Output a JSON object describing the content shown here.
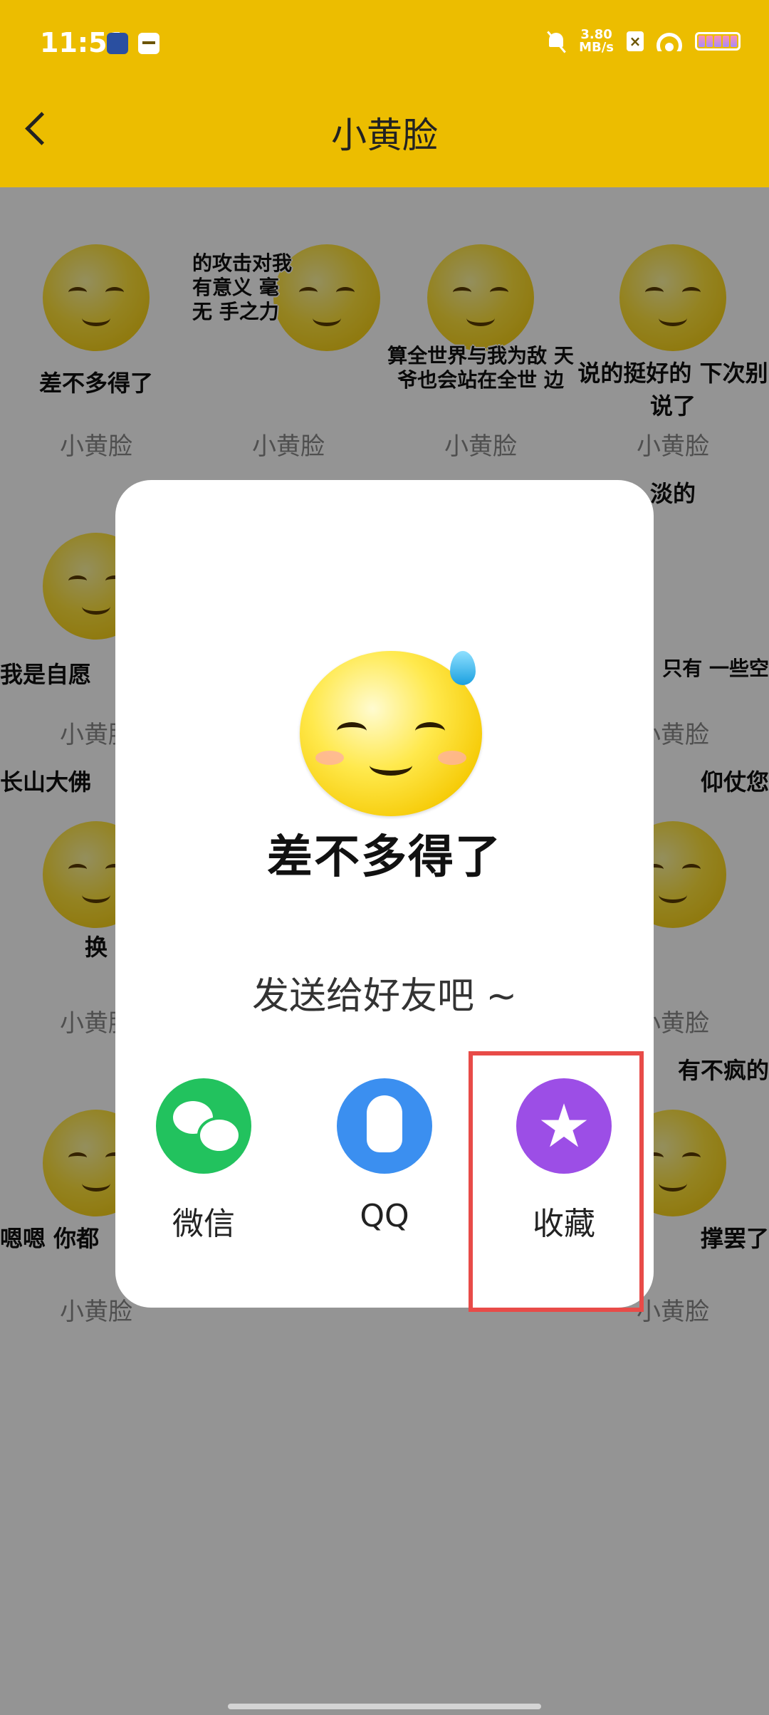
{
  "status_bar": {
    "time": "11:51",
    "net_speed_value": "3.80",
    "net_speed_unit": "MB/s",
    "colors": {
      "background": "#ecbd00"
    }
  },
  "header": {
    "title": "小黄脸",
    "back_icon": "chevron-left-icon"
  },
  "grid": {
    "items": [
      {
        "caption": "差不多得了",
        "name": "小黄脸"
      },
      {
        "caption": "的攻击对我 有意义 毫无 手之力",
        "name": "小黄脸"
      },
      {
        "caption": "算全世界与我为敌 天爷也会站在全世 边",
        "name": "小黄脸"
      },
      {
        "caption": "说的挺好的 下次别说了",
        "name": "小黄脸"
      },
      {
        "caption": "我是自愿",
        "name": "小黄脸"
      },
      {
        "caption": "只有 一些空",
        "name": "小黄脸",
        "top_caption": "淡的"
      },
      {
        "caption": "换",
        "name": "小黄脸",
        "top_caption": "长山大佛"
      },
      {
        "caption": "",
        "name": "小黄脸",
        "top_caption": "仰仗您"
      },
      {
        "caption": "嗯嗯 你都",
        "name": "小黄脸"
      },
      {
        "caption": "撑罢了",
        "name": "小黄脸",
        "top_caption": "有不疯的"
      }
    ]
  },
  "dialog": {
    "emoji_caption": "差不多得了",
    "send_hint": "发送给好友吧 ~",
    "share_options": [
      {
        "label": "微信",
        "icon": "wechat-icon",
        "color": "#22c25e"
      },
      {
        "label": "QQ",
        "icon": "qq-penguin-icon",
        "color": "#3b8ff0"
      },
      {
        "label": "收藏",
        "icon": "star-icon",
        "color": "#9c4ee6"
      }
    ]
  },
  "highlight": {
    "target": "收藏",
    "color": "#e84b48"
  }
}
